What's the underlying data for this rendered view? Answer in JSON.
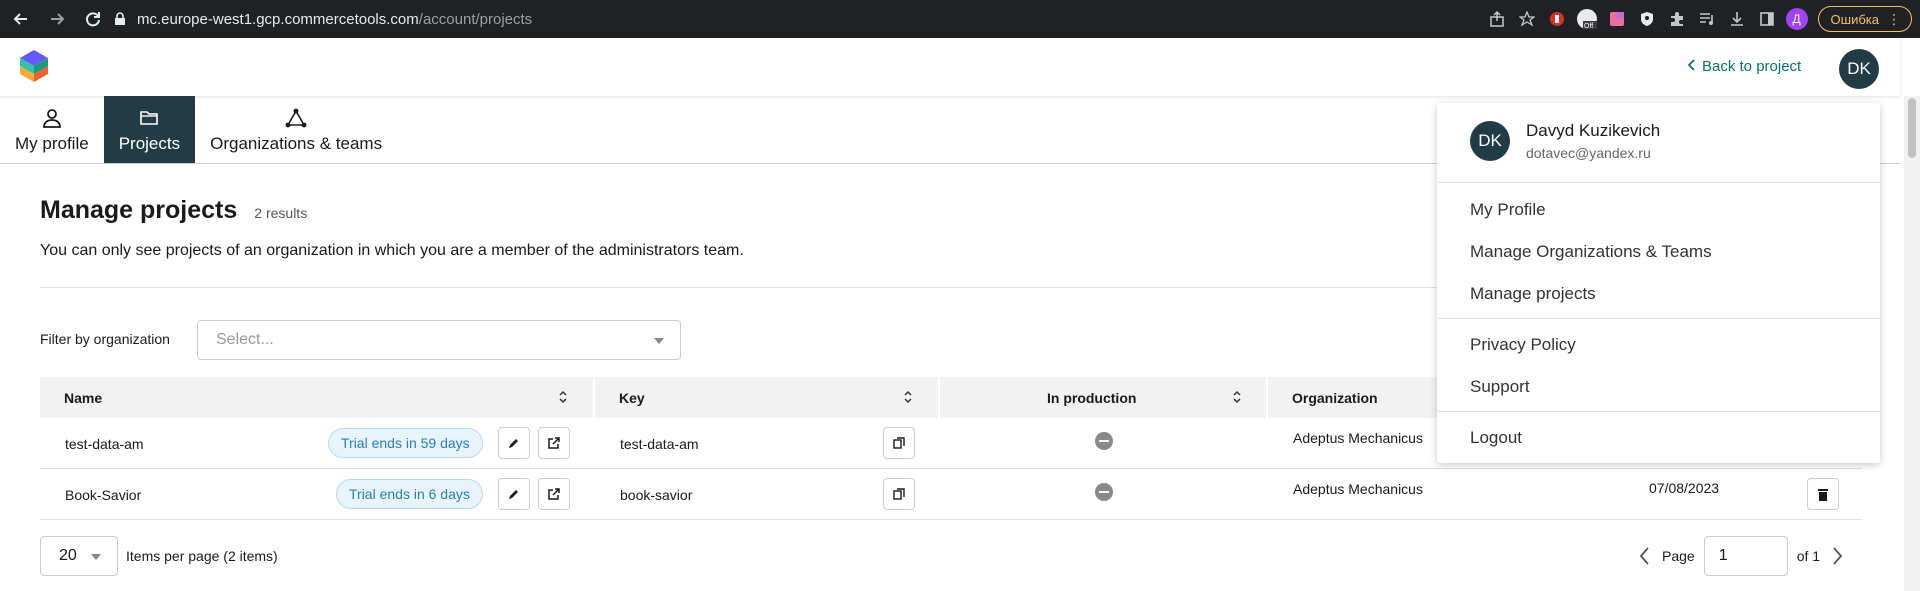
{
  "browser": {
    "url_host": "mc.europe-west1.gcp.commercetools.com",
    "url_path": "/account/projects",
    "profile_initial": "Д",
    "error_label": "Ошибка",
    "extension_badge": "Off"
  },
  "header": {
    "back_label": "Back to project",
    "user_initials": "DK"
  },
  "tabs": [
    {
      "label": "My profile",
      "icon": "user-icon"
    },
    {
      "label": "Projects",
      "icon": "folder-icon",
      "active": true
    },
    {
      "label": "Organizations & teams",
      "icon": "organization-icon"
    }
  ],
  "main": {
    "title": "Manage projects",
    "result_count": "2 results",
    "subtitle": "You can only see projects of an organization in which you are a member of the administrators team.",
    "filter_label": "Filter by organization",
    "filter_placeholder": "Select..."
  },
  "table": {
    "columns": [
      "Name",
      "Key",
      "In production",
      "Organization"
    ],
    "rows": [
      {
        "name": "test-data-am",
        "trial": "Trial ends in 59 days",
        "key": "test-data-am",
        "in_production": false,
        "organization": "Adeptus Mechanicus",
        "date": ""
      },
      {
        "name": "Book-Savior",
        "trial": "Trial ends in 6 days",
        "key": "book-savior",
        "in_production": false,
        "organization": "Adeptus Mechanicus",
        "date": "07/08/2023"
      }
    ]
  },
  "pagination": {
    "per_page": "20",
    "per_page_label": "Items per page (2 items)",
    "page_label": "Page",
    "page_value": "1",
    "of_label": "of 1"
  },
  "dropdown": {
    "initials": "DK",
    "name": "Davyd Kuzikevich",
    "email": "dotavec@yandex.ru",
    "items": [
      "My Profile",
      "Manage Organizations & Teams",
      "Manage projects",
      "Privacy Policy",
      "Support",
      "Logout"
    ]
  },
  "colors": {
    "brand_dark": "#213c45",
    "link_teal": "#0b6f76",
    "trial_blue": "#2a7fb8"
  }
}
